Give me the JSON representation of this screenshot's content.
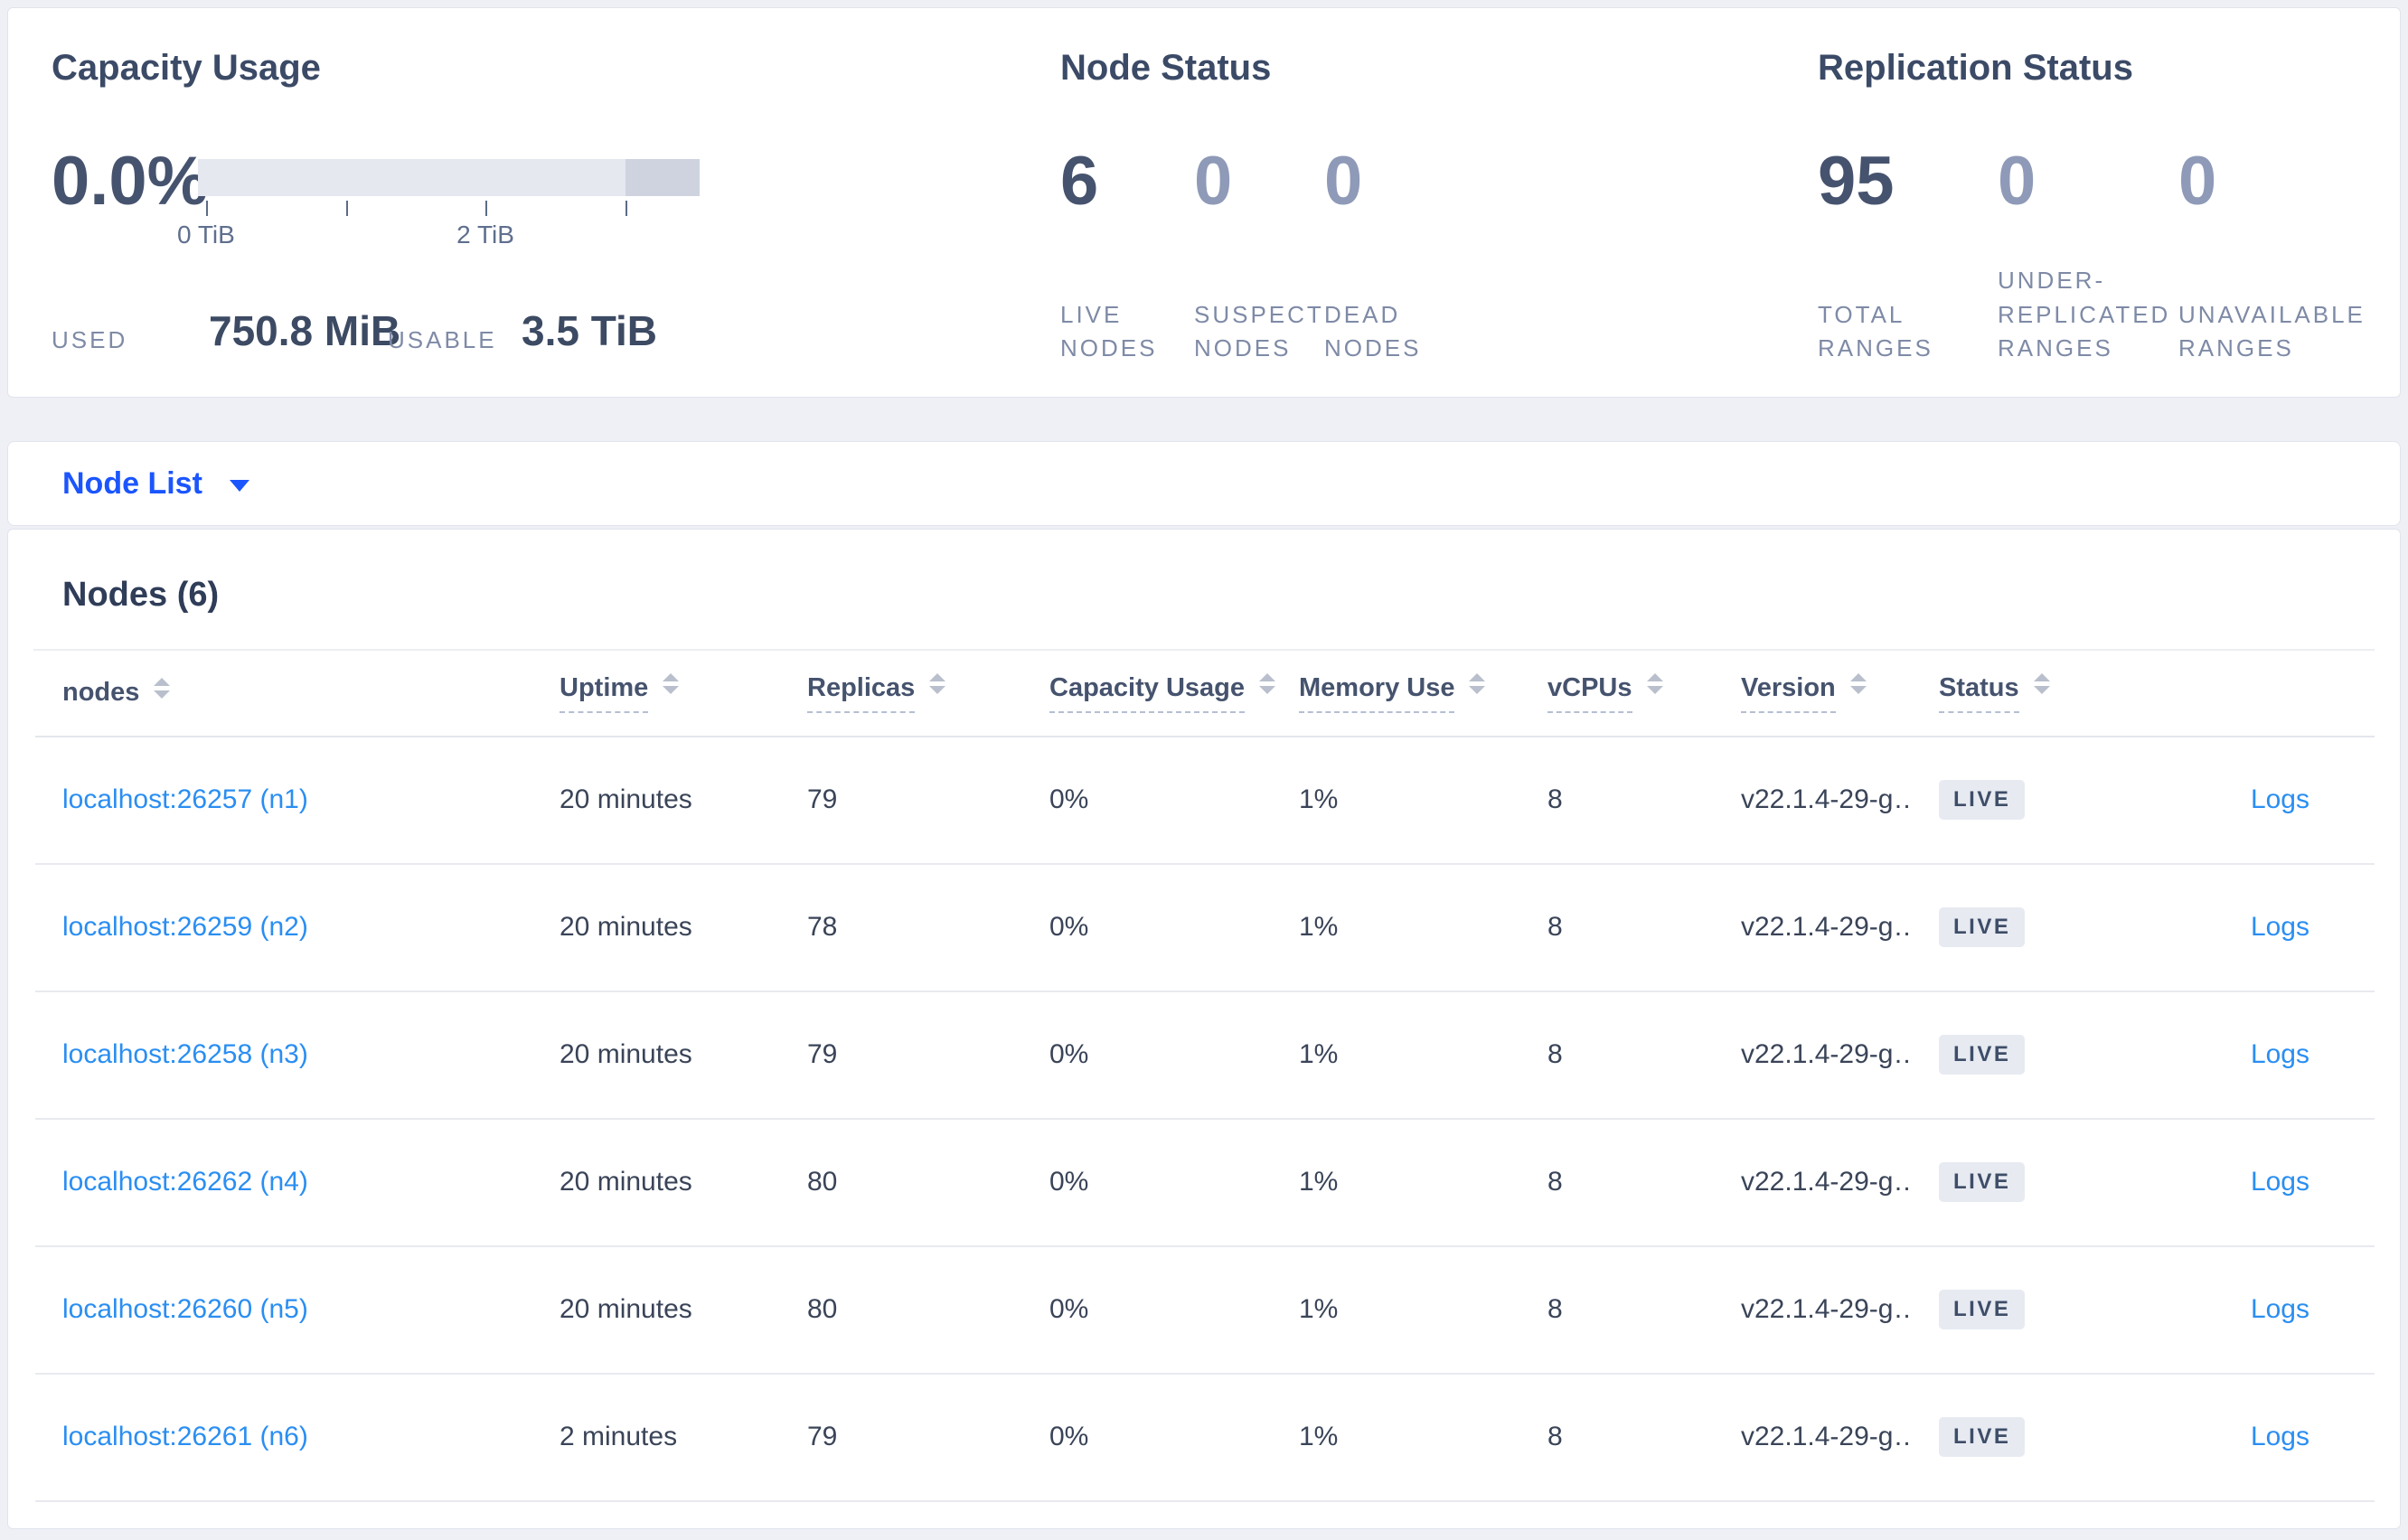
{
  "panels": {
    "capacity": {
      "title": "Capacity Usage",
      "percent": "0.0%",
      "bar": {
        "segments": [
          {
            "name": "usable-track",
            "width_pct": 85.2,
            "color": "#e6e8f0"
          },
          {
            "name": "reserved-track",
            "width_pct": 14.8,
            "color": "#ced3df"
          }
        ],
        "ticks": [
          {
            "pct": 1.6,
            "label": "0 TiB"
          },
          {
            "pct": 29.5,
            "label": ""
          },
          {
            "pct": 57.3,
            "label": "2 TiB"
          },
          {
            "pct": 85.2,
            "label": ""
          }
        ]
      },
      "used_label": "USED",
      "used_value": "750.8 MiB",
      "usable_label": "USABLE",
      "usable_value": "3.5 TiB"
    },
    "node_status": {
      "title": "Node Status",
      "metrics": [
        {
          "value": "6",
          "label": "LIVE NODES",
          "emphasis": true
        },
        {
          "value": "0",
          "label": "SUSPECT NODES",
          "emphasis": false
        },
        {
          "value": "0",
          "label": "DEAD NODES",
          "emphasis": false
        }
      ]
    },
    "replication": {
      "title": "Replication Status",
      "metrics": [
        {
          "value": "95",
          "label": "TOTAL RANGES",
          "emphasis": true
        },
        {
          "value": "0",
          "label": "UNDER-REPLICATED RANGES",
          "emphasis": false
        },
        {
          "value": "0",
          "label": "UNAVAILABLE RANGES",
          "emphasis": false
        }
      ]
    }
  },
  "node_list": {
    "label": "Node List"
  },
  "nodes_section": {
    "title": "Nodes (6)",
    "columns": [
      {
        "key": "address",
        "label": "nodes",
        "sortable": true,
        "underline": false
      },
      {
        "key": "uptime",
        "label": "Uptime",
        "sortable": true,
        "underline": true
      },
      {
        "key": "replicas",
        "label": "Replicas",
        "sortable": true,
        "underline": true
      },
      {
        "key": "capacity",
        "label": "Capacity Usage",
        "sortable": true,
        "underline": true
      },
      {
        "key": "memory",
        "label": "Memory Use",
        "sortable": true,
        "underline": true
      },
      {
        "key": "vcpus",
        "label": "vCPUs",
        "sortable": true,
        "underline": true
      },
      {
        "key": "version",
        "label": "Version",
        "sortable": true,
        "underline": true
      },
      {
        "key": "status",
        "label": "Status",
        "sortable": true,
        "underline": true
      },
      {
        "key": "logs",
        "label": "",
        "sortable": false,
        "underline": false
      }
    ],
    "rows": [
      {
        "address": "localhost:26257 (n1)",
        "uptime": "20 minutes",
        "replicas": "79",
        "capacity": "0%",
        "memory": "1%",
        "vcpus": "8",
        "version": "v22.1.4-29-g…",
        "status": "LIVE",
        "logs": "Logs"
      },
      {
        "address": "localhost:26259 (n2)",
        "uptime": "20 minutes",
        "replicas": "78",
        "capacity": "0%",
        "memory": "1%",
        "vcpus": "8",
        "version": "v22.1.4-29-g…",
        "status": "LIVE",
        "logs": "Logs"
      },
      {
        "address": "localhost:26258 (n3)",
        "uptime": "20 minutes",
        "replicas": "79",
        "capacity": "0%",
        "memory": "1%",
        "vcpus": "8",
        "version": "v22.1.4-29-g…",
        "status": "LIVE",
        "logs": "Logs"
      },
      {
        "address": "localhost:26262 (n4)",
        "uptime": "20 minutes",
        "replicas": "80",
        "capacity": "0%",
        "memory": "1%",
        "vcpus": "8",
        "version": "v22.1.4-29-g…",
        "status": "LIVE",
        "logs": "Logs"
      },
      {
        "address": "localhost:26260 (n5)",
        "uptime": "20 minutes",
        "replicas": "80",
        "capacity": "0%",
        "memory": "1%",
        "vcpus": "8",
        "version": "v22.1.4-29-g…",
        "status": "LIVE",
        "logs": "Logs"
      },
      {
        "address": "localhost:26261 (n6)",
        "uptime": "2 minutes",
        "replicas": "79",
        "capacity": "0%",
        "memory": "1%",
        "vcpus": "8",
        "version": "v22.1.4-29-g…",
        "status": "LIVE",
        "logs": "Logs"
      }
    ]
  },
  "colors": {
    "dropdown_blue": "#1b55fe",
    "link_blue": "#2a8ef2",
    "heading": "#3b4a66",
    "metric_emphasis": "#46536e",
    "metric_muted": "#8e9ab7",
    "label_muted": "#7e8aa6",
    "badge_bg": "#e7eaf1",
    "badge_text": "#3e4d68",
    "bar_light": "#e6e8f0",
    "bar_dark": "#ced3df"
  }
}
